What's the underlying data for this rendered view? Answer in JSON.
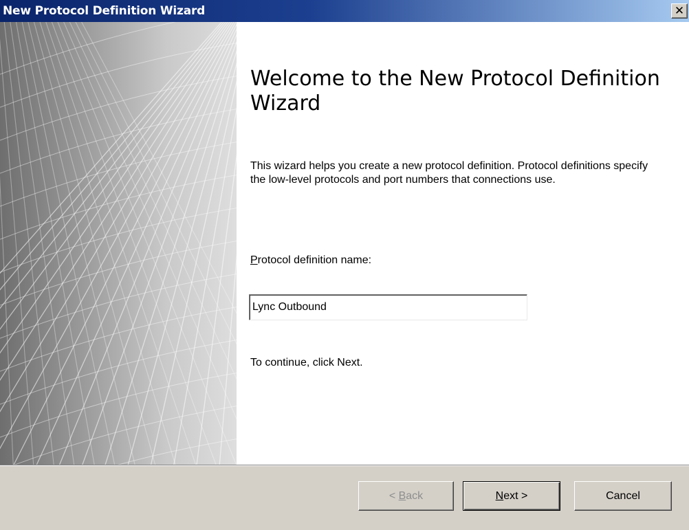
{
  "window": {
    "title": "New Protocol Definition Wizard",
    "close_glyph": "✕"
  },
  "main": {
    "heading": "Welcome to the New Protocol Definition Wizard",
    "description": "This wizard helps you create a new protocol definition. Protocol definitions specify the low-level protocols and port numbers that connections use.",
    "field_label_accel": "P",
    "field_label_rest": "rotocol definition name:",
    "field_value": "Lync Outbound",
    "continue_text": "To continue, click Next."
  },
  "buttons": {
    "back_prefix": "< ",
    "back_accel": "B",
    "back_rest": "ack",
    "next_accel": "N",
    "next_rest": "ext >",
    "cancel": "Cancel"
  },
  "colors": {
    "title_gradient_start": "#0a246a",
    "title_gradient_end": "#a6caf0",
    "dialog_face": "#d4d0c8",
    "content_bg": "#ffffff"
  },
  "icons": {
    "close": "close-icon",
    "banner": "wireframe-banner-graphic"
  }
}
